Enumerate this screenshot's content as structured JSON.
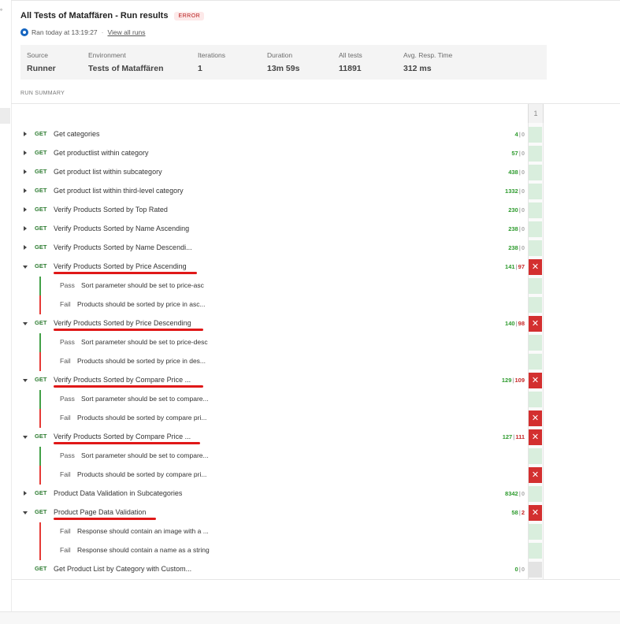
{
  "title": "All Tests of Mataffären - Run results",
  "status_badge": "ERROR",
  "meta": {
    "ran": "Ran today at 13:19:27",
    "separator": "·",
    "view_all": "View all runs"
  },
  "stats": [
    {
      "label": "Source",
      "value": "Runner"
    },
    {
      "label": "Environment",
      "value": "Tests of Mataffären"
    },
    {
      "label": "Iterations",
      "value": "1"
    },
    {
      "label": "Duration",
      "value": "13m 59s"
    },
    {
      "label": "All tests",
      "value": "11891"
    },
    {
      "label": "Avg. Resp. Time",
      "value": "312 ms"
    }
  ],
  "run_summary_label": "RUN SUMMARY",
  "iteration_header": "1",
  "gutter_mark": "°",
  "requests": [
    {
      "method": "GET",
      "name": "Get categories",
      "pass": "4",
      "fail": "0"
    },
    {
      "method": "GET",
      "name": "Get productlist within category",
      "pass": "57",
      "fail": "0"
    },
    {
      "method": "GET",
      "name": "Get product list within subcategory",
      "pass": "438",
      "fail": "0"
    },
    {
      "method": "GET",
      "name": "Get product list within third-level category",
      "pass": "1332",
      "fail": "0"
    },
    {
      "method": "GET",
      "name": "Verify Products Sorted by Top Rated",
      "pass": "230",
      "fail": "0"
    },
    {
      "method": "GET",
      "name": "Verify Products Sorted by Name Ascending",
      "pass": "238",
      "fail": "0"
    },
    {
      "method": "GET",
      "name": "Verify Products Sorted by Name Descendi...",
      "pass": "238",
      "fail": "0"
    },
    {
      "method": "GET",
      "name": "Verify Products Sorted by Price Ascending",
      "pass": "141",
      "fail": "97",
      "assertions": [
        {
          "status": "Pass",
          "text": "Sort parameter should be set to price-asc"
        },
        {
          "status": "Fail",
          "text": "Products should be sorted by price in asc..."
        }
      ]
    },
    {
      "method": "GET",
      "name": "Verify Products Sorted by Price Descending",
      "pass": "140",
      "fail": "98",
      "assertions": [
        {
          "status": "Pass",
          "text": "Sort parameter should be set to price-desc"
        },
        {
          "status": "Fail",
          "text": "Products should be sorted by price in des..."
        }
      ]
    },
    {
      "method": "GET",
      "name": "Verify Products Sorted by Compare Price ...",
      "pass": "129",
      "fail": "109",
      "assertions": [
        {
          "status": "Pass",
          "text": "Sort parameter should be set to compare..."
        },
        {
          "status": "Fail",
          "text": "Products should be sorted by compare pri..."
        }
      ]
    },
    {
      "method": "GET",
      "name": "Verify Products Sorted by Compare Price ...",
      "pass": "127",
      "fail": "111",
      "assertions": [
        {
          "status": "Pass",
          "text": "Sort parameter should be set to compare..."
        },
        {
          "status": "Fail",
          "text": "Products should be sorted by compare pri..."
        }
      ]
    },
    {
      "method": "GET",
      "name": "Product Data Validation in Subcategories",
      "pass": "8342",
      "fail": "0"
    },
    {
      "method": "GET",
      "name": "Product Page Data Validation",
      "pass": "58",
      "fail": "2",
      "assertions": [
        {
          "status": "Fail",
          "text": "Response should contain an image with a ..."
        },
        {
          "status": "Fail",
          "text": "Response should contain a name as a string"
        }
      ]
    },
    {
      "method": "GET",
      "name": "Get Product List by Category with Custom...",
      "pass": "0",
      "fail": "0"
    }
  ]
}
